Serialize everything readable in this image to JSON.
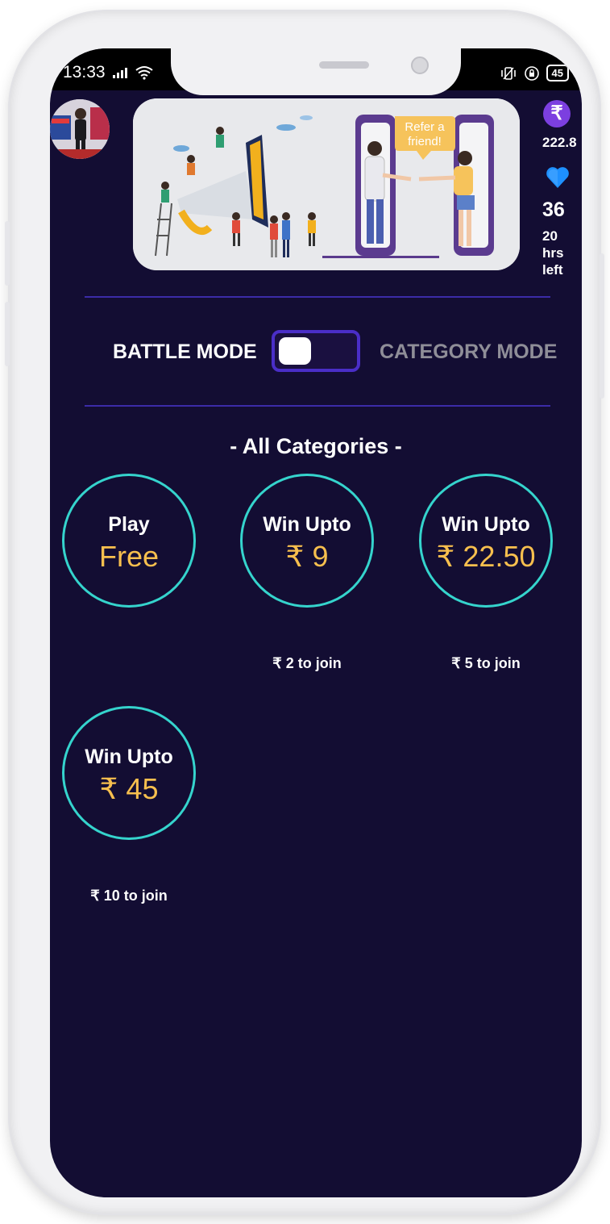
{
  "status_bar": {
    "time": "13:33",
    "battery": "45"
  },
  "header": {
    "banner": {
      "bubble_line1": "Refer a",
      "bubble_line2": "friend!"
    },
    "coins": "222.8",
    "lives": "36",
    "time_left": "20 hrs left",
    "icons": {
      "coin": "rupee-coin-icon",
      "lives": "blue-heart-icon"
    }
  },
  "mode": {
    "left_label": "BATTLE MODE",
    "right_label": "CATEGORY MODE"
  },
  "section_title": "- All Categories -",
  "categories": [
    {
      "label": "Play",
      "value": "Free",
      "join": ""
    },
    {
      "label": "Win Upto",
      "value": "₹ 9",
      "join": "₹ 2 to join"
    },
    {
      "label": "Win Upto",
      "value": "₹ 22.50",
      "join": "₹ 5 to join"
    },
    {
      "label": "Win Upto",
      "value": "₹ 45",
      "join": "₹ 10 to join"
    }
  ],
  "colors": {
    "background": "#130d33",
    "circle_border": "#35d4cd",
    "prize_text": "#f7bf4e",
    "toggle_accent": "#4a2ec7",
    "coin": "#7c3fe0"
  }
}
